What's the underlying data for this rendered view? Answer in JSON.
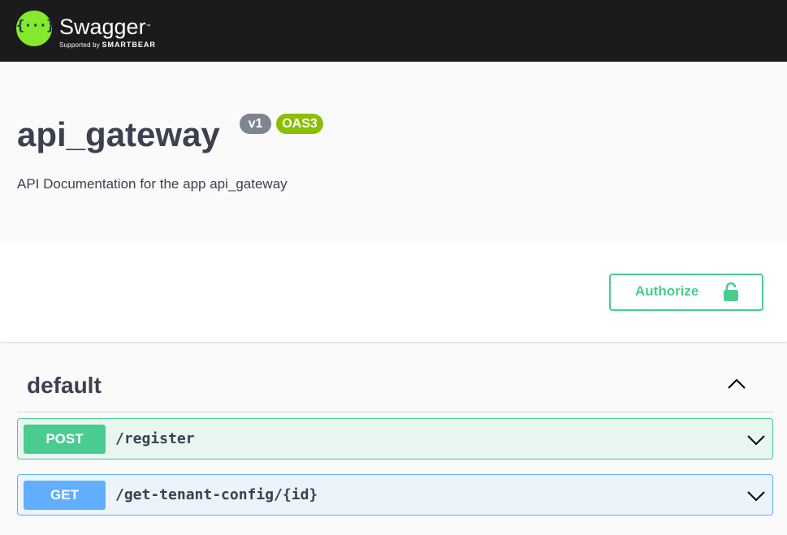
{
  "topbar": {
    "logo_glyph": "{···}",
    "logo_title": "Swagger",
    "logo_tm": "™",
    "logo_sub_prefix": "Supported by",
    "logo_sub_brand": "SMARTBEAR",
    "logo_color": "#85ea2d",
    "background": "#1b1b1b"
  },
  "info": {
    "title": "api_gateway",
    "version_badge": "v1",
    "oas_badge": "OAS3",
    "description": "API Documentation for the app api_gateway"
  },
  "scheme": {
    "authorize_label": "Authorize",
    "authorize_icon": "unlocked-lock-icon",
    "accent": "#49cc90"
  },
  "tag": {
    "name": "default",
    "toggle_icon": "chevron-up-icon"
  },
  "operations": [
    {
      "method": "POST",
      "path": "/register",
      "color": "#49cc90",
      "toggle_icon": "chevron-down-icon"
    },
    {
      "method": "GET",
      "path": "/get-tenant-config/{id}",
      "color": "#61affe",
      "toggle_icon": "chevron-down-icon"
    }
  ]
}
